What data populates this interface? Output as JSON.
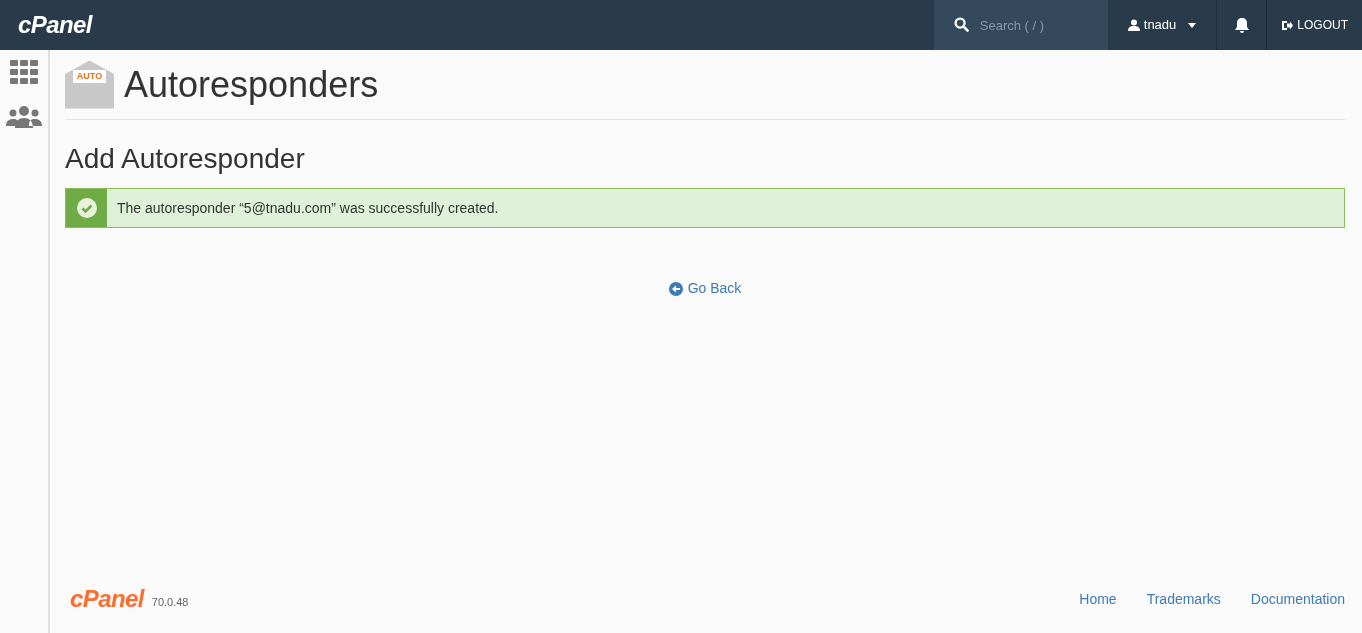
{
  "header": {
    "logo": "cPanel",
    "search": {
      "placeholder": "Search ( / )"
    },
    "user": "tnadu",
    "logout": "LOGOUT"
  },
  "page": {
    "icon_label": "AUTO",
    "title": "Autoresponders",
    "subtitle": "Add Autoresponder"
  },
  "alert": {
    "kind": "success",
    "message": "The autoresponder “5@tnadu.com” was successfully created."
  },
  "go_back": "Go Back",
  "footer": {
    "logo": "cPanel",
    "version": "70.0.48",
    "links": [
      "Home",
      "Trademarks",
      "Documentation"
    ]
  }
}
